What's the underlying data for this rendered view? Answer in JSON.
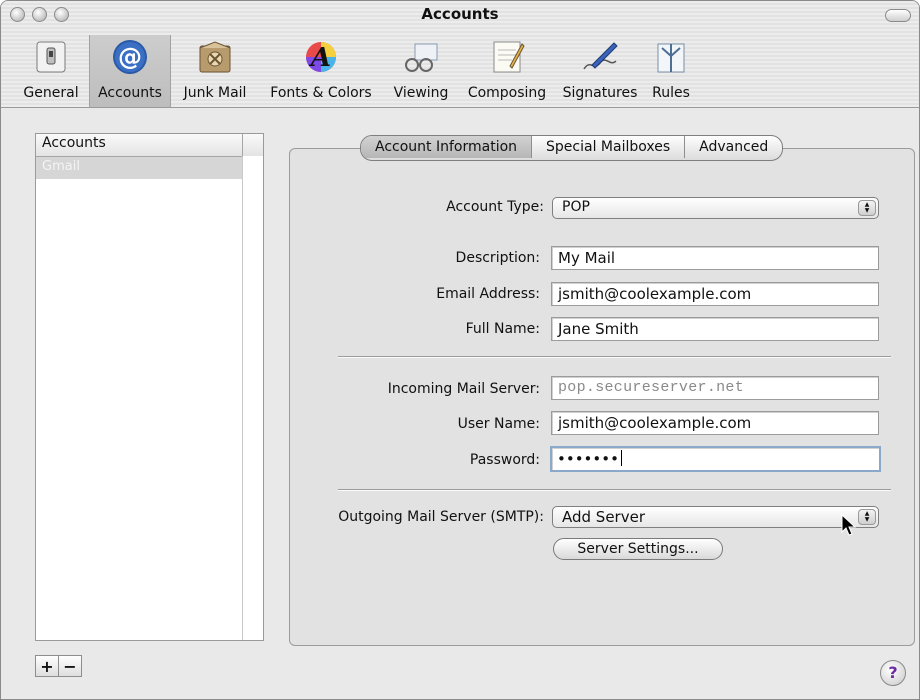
{
  "window": {
    "title": "Accounts"
  },
  "toolbar": {
    "items": [
      {
        "label": "General",
        "icon": "switch-icon"
      },
      {
        "label": "Accounts",
        "icon": "at-icon",
        "selected": true
      },
      {
        "label": "Junk Mail",
        "icon": "junk-mail-icon"
      },
      {
        "label": "Fonts & Colors",
        "icon": "color-font-icon"
      },
      {
        "label": "Viewing",
        "icon": "glasses-icon"
      },
      {
        "label": "Composing",
        "icon": "pencil-pad-icon"
      },
      {
        "label": "Signatures",
        "icon": "pen-signature-icon"
      },
      {
        "label": "Rules",
        "icon": "rules-icon"
      }
    ]
  },
  "accounts_list": {
    "header": "Accounts",
    "rows": [
      "Gmail"
    ]
  },
  "tabs": {
    "account_information": "Account Information",
    "special_mailboxes": "Special Mailboxes",
    "advanced": "Advanced"
  },
  "form": {
    "account_type": {
      "label": "Account Type:",
      "value": "POP"
    },
    "description": {
      "label": "Description:",
      "value": "My Mail"
    },
    "email": {
      "label": "Email Address:",
      "value": "jsmith@coolexample.com"
    },
    "full_name": {
      "label": "Full Name:",
      "value": "Jane Smith"
    },
    "incoming_server": {
      "label": "Incoming Mail Server:",
      "value": "pop.secureserver.net"
    },
    "user_name": {
      "label": "User Name:",
      "value": "jsmith@coolexample.com"
    },
    "password": {
      "label": "Password:",
      "value": "•••••••"
    },
    "outgoing_server": {
      "label": "Outgoing Mail Server (SMTP):",
      "value": "Add Server"
    },
    "server_settings": "Server Settings..."
  },
  "buttons": {
    "add": "+",
    "remove": "−",
    "help": "?"
  },
  "colors": {
    "selection_row": "#d6d6d6",
    "focus_ring": "#8aa8c9",
    "help_glyph": "#6a2ba3"
  }
}
